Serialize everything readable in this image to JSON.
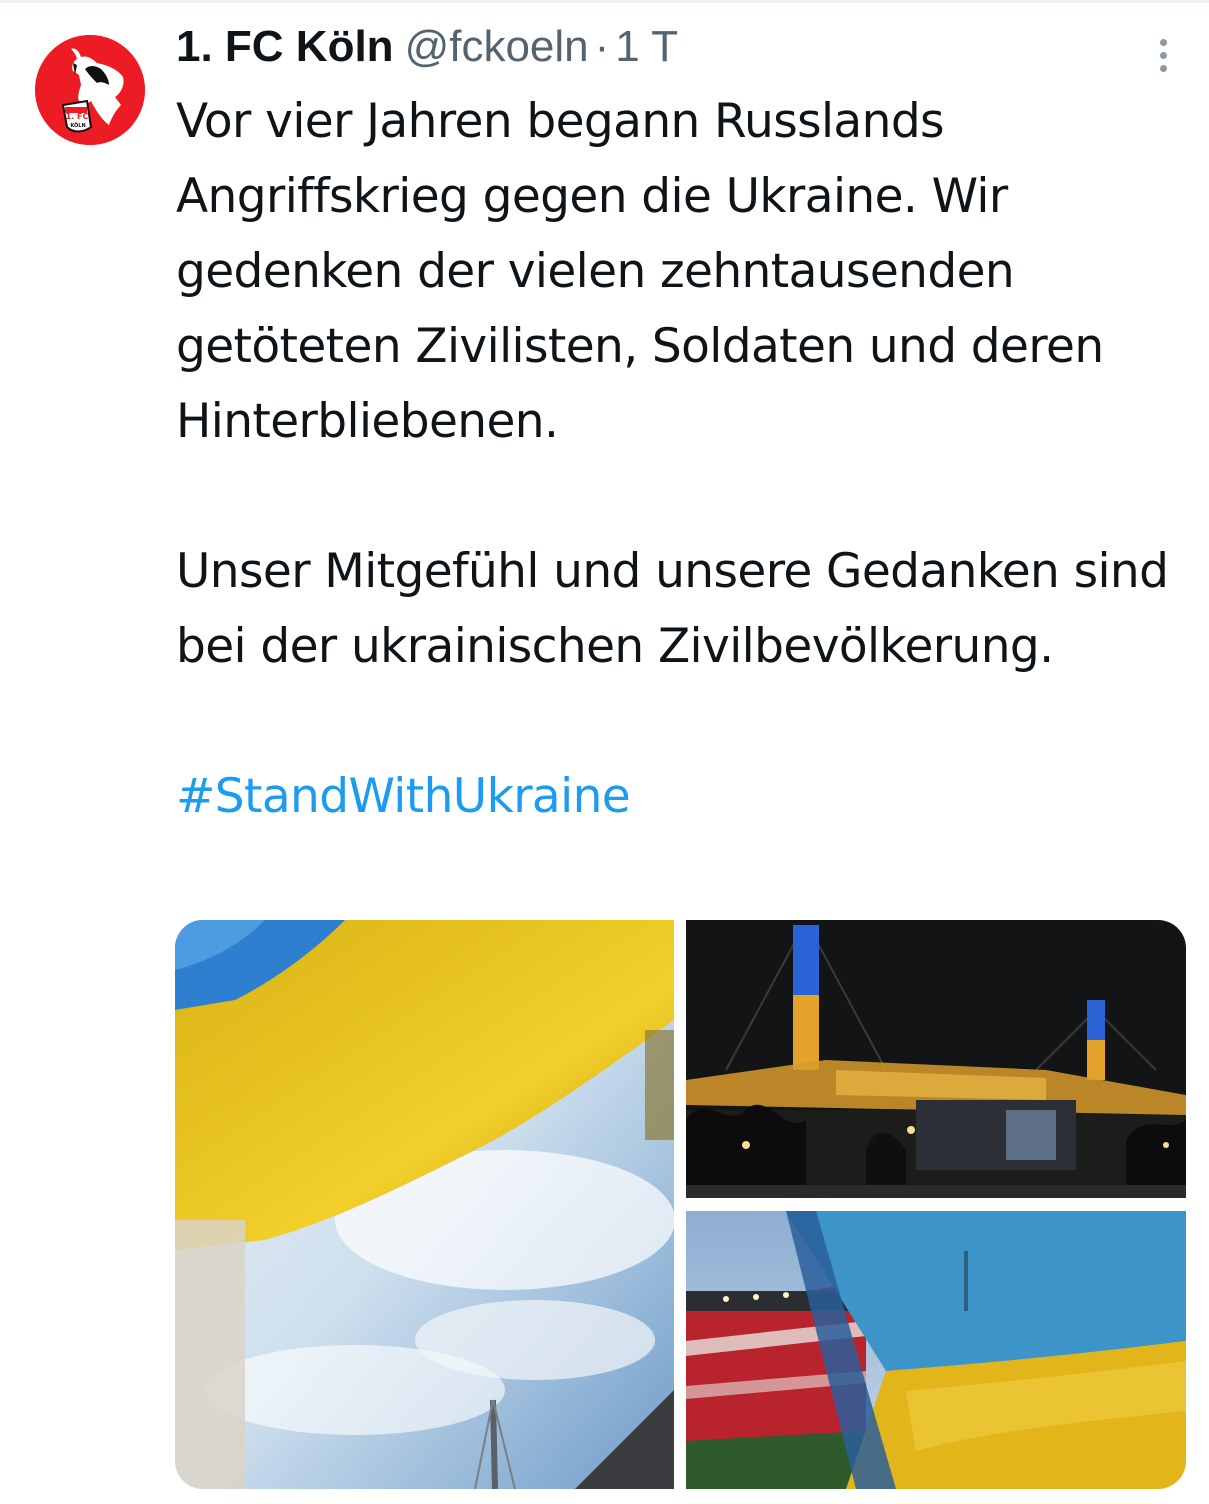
{
  "tweet": {
    "author": {
      "display_name": "1. FC Köln",
      "handle": "@fckoeln",
      "separator": "·",
      "time": "1 T",
      "avatar": {
        "logo_text_top": "1. FC",
        "logo_text_bottom": "KÖLN",
        "brand_color": "#ed1c24"
      }
    },
    "body": {
      "paragraph_1": "Vor vier Jahren begann Russlands Angriffskrieg gegen die Ukraine. Wir gedenken der vielen zehntausenden getöteten Zivilisten, Soldaten und deren Hinterbliebenen.",
      "paragraph_2": "Unser Mitgefühl und unsere Gedanken sind bei der ukrainischen Zivilbevölkerung.",
      "hashtag": "#StandWithUkraine"
    },
    "more_icon": "more-vertical-icon",
    "colors": {
      "text": "#0f1419",
      "secondary": "#536471",
      "link": "#1d9bf0",
      "flag_blue": "#2f7fd0",
      "flag_yellow": "#f2c81a"
    }
  }
}
